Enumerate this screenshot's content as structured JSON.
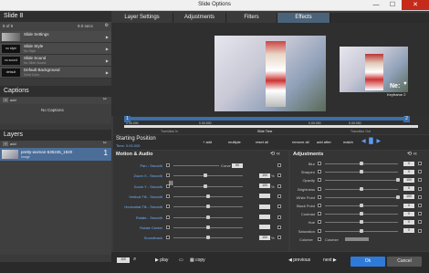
{
  "window": {
    "title": "Slide Options",
    "minimize": "—",
    "maximize": "☐",
    "close": "✕"
  },
  "left": {
    "slide_header": "Slide 8",
    "slide_bar": {
      "counter": "8 of 9",
      "time": "9.0 secs"
    },
    "rows": [
      {
        "thumb": "",
        "name": "Slide Settings",
        "sub": ""
      },
      {
        "thumb": "no style",
        "name": "Slide Style",
        "sub": "No Style"
      },
      {
        "thumb": "no sound",
        "name": "Slide Sound",
        "sub": "No Slide Sound"
      },
      {
        "thumb": "default",
        "name": "Default Background",
        "sub": "Solid Color"
      }
    ],
    "captions_header": "Captions",
    "add": "add",
    "no_captions": "No Captions",
    "layers_header": "Layers",
    "layer": {
      "name": "pretty-woman-635245_1920",
      "type": "Image",
      "number": "1"
    }
  },
  "tabs": [
    "Layer Settings",
    "Adjustments",
    "Filters",
    "Effects"
  ],
  "preview": {
    "next_label": "Ne:",
    "keyframe": "Keyframe 2"
  },
  "timeline": {
    "times": [
      "0.00.000",
      "0.00.500",
      "0.00.000",
      "0.00.000"
    ],
    "markers": [
      "1",
      "2"
    ],
    "segments": [
      "Transition In",
      "Slide Time",
      "Transition Out"
    ]
  },
  "position": {
    "title": "Starting Position",
    "time": "Time: 0.00.000",
    "add": "add",
    "multiple": "multiple",
    "reset_all": "reset all",
    "remove_all": "remove all",
    "add_after": "add after",
    "match": "match"
  },
  "motion": {
    "title": "Motion & Audio",
    "rows": [
      {
        "label": "Pan",
        "smooth": "- Smooth",
        "extra": "Curve",
        "val": "50"
      },
      {
        "label": "Zoom X",
        "smooth": "- Smooth",
        "val": "100"
      },
      {
        "label": "Zoom Y",
        "smooth": "- Smooth",
        "val": "100"
      },
      {
        "label": "Vertical Tilt",
        "smooth": "- Smooth",
        "val": ""
      },
      {
        "label": "Horizontal Tilt",
        "smooth": "- Smooth",
        "val": ""
      },
      {
        "label": "Rotate",
        "smooth": "- Smooth",
        "val": ""
      },
      {
        "label": "Rotate Center",
        "smooth": "",
        "val": ""
      },
      {
        "label": "Soundtrack",
        "smooth": "",
        "val": "100"
      }
    ],
    "pct": "%"
  },
  "adjust": {
    "title": "Adjustments",
    "rows": [
      "Blur",
      "Sharpen",
      "Opacity",
      "Brightness",
      "White Point",
      "Black Point",
      "Contrast",
      "Hue",
      "Saturation"
    ],
    "values": [
      "0",
      "0",
      "100",
      "0",
      "100",
      "0",
      "0",
      "0",
      "0"
    ],
    "colorize": "Colorize",
    "colorize2": "Colorize"
  },
  "bottom": {
    "zoom": "100",
    "play": "play",
    "copy": "copy",
    "previous": "previous",
    "next": "next",
    "ok": "Ok",
    "cancel": "Cancel"
  }
}
